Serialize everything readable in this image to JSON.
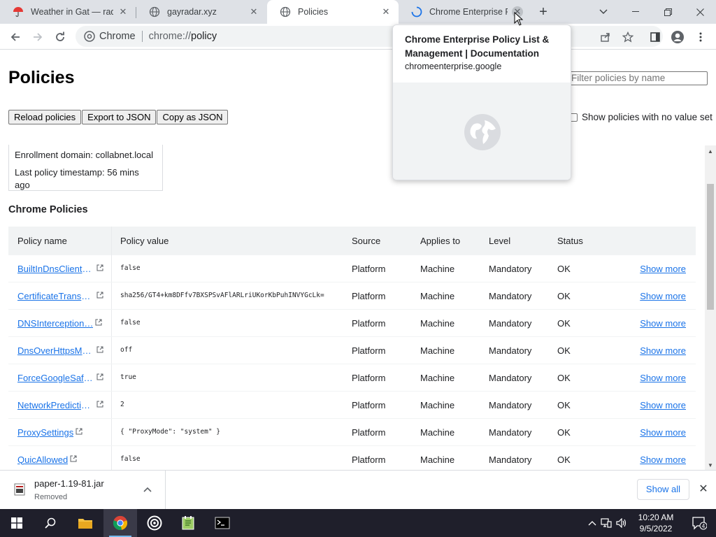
{
  "tabs": [
    {
      "title": "Weather in Gat — rada",
      "favicon": "umbrella-icon"
    },
    {
      "title": "gayradar.xyz",
      "favicon": "globe-icon"
    },
    {
      "title": "Policies",
      "favicon": "globe-icon",
      "active": true
    },
    {
      "title": "Chrome Enterprise Poli",
      "favicon": "loading-icon"
    }
  ],
  "omnibox": {
    "badge": "Chrome",
    "url_scheme": "chrome://",
    "url_host": "policy"
  },
  "hovercard": {
    "title": "Chrome Enterprise Policy List & Management | Documentation",
    "domain": "chromeenterprise.google"
  },
  "page": {
    "title": "Policies",
    "filter_placeholder": "Filter policies by name",
    "buttons": {
      "reload": "Reload policies",
      "export": "Export to JSON",
      "copy": "Copy as JSON"
    },
    "show_no_value": "Show policies with no value set",
    "status": {
      "enrollment": "Enrollment domain: collabnet.local",
      "timestamp": "Last policy timestamp: 56 mins ago"
    },
    "section_title": "Chrome Policies",
    "table": {
      "headers": {
        "name": "Policy name",
        "value": "Policy value",
        "source": "Source",
        "applies": "Applies to",
        "level": "Level",
        "status": "Status"
      },
      "show_more": "Show more",
      "rows": [
        {
          "name": "BuiltInDnsClientE…",
          "value": "false",
          "source": "Platform",
          "applies": "Machine",
          "level": "Mandatory",
          "status": "OK"
        },
        {
          "name": "CertificateTransp…",
          "value": "sha256/GT4+km8DFfv7BXSPSvAFlARLriUKorKbPuhINVYGcLk=",
          "source": "Platform",
          "applies": "Machine",
          "level": "Mandatory",
          "status": "OK"
        },
        {
          "name": "DNSInterception…",
          "value": "false",
          "source": "Platform",
          "applies": "Machine",
          "level": "Mandatory",
          "status": "OK"
        },
        {
          "name": "DnsOverHttpsMo…",
          "value": "off",
          "source": "Platform",
          "applies": "Machine",
          "level": "Mandatory",
          "status": "OK"
        },
        {
          "name": "ForceGoogleSafe…",
          "value": "true",
          "source": "Platform",
          "applies": "Machine",
          "level": "Mandatory",
          "status": "OK"
        },
        {
          "name": "NetworkPredictio…",
          "value": "2",
          "source": "Platform",
          "applies": "Machine",
          "level": "Mandatory",
          "status": "OK"
        },
        {
          "name": "ProxySettings",
          "value": "{ \"ProxyMode\": \"system\" }",
          "source": "Platform",
          "applies": "Machine",
          "level": "Mandatory",
          "status": "OK"
        },
        {
          "name": "QuicAllowed",
          "value": "false",
          "source": "Platform",
          "applies": "Machine",
          "level": "Mandatory",
          "status": "OK"
        }
      ]
    }
  },
  "downloads": {
    "file_name": "paper-1.19-81.jar",
    "file_status": "Removed",
    "show_all": "Show all"
  },
  "taskbar": {
    "time": "10:20 AM",
    "date": "9/5/2022",
    "notification_count": "4"
  },
  "colors": {
    "link": "#1a73e8",
    "tabstrip": "#dee1e6",
    "taskbar": "#1f1f2b"
  }
}
